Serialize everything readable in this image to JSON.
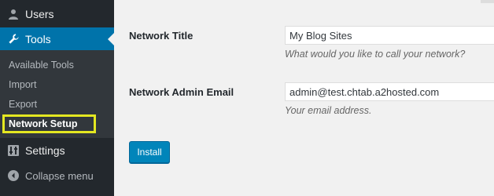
{
  "sidebar": {
    "users": {
      "label": "Users",
      "icon": "user-icon"
    },
    "tools": {
      "label": "Tools",
      "icon": "wrench-icon"
    },
    "submenu": [
      {
        "label": "Available Tools"
      },
      {
        "label": "Import"
      },
      {
        "label": "Export"
      },
      {
        "label": "Network Setup",
        "current": true
      }
    ],
    "settings": {
      "label": "Settings",
      "icon": "settings-sliders-icon"
    },
    "collapse": {
      "label": "Collapse menu",
      "icon": "collapse-arrow-icon"
    }
  },
  "form": {
    "network_title": {
      "label": "Network Title",
      "value": "My Blog Sites",
      "description": "What would you like to call your network?"
    },
    "admin_email": {
      "label": "Network Admin Email",
      "value": "admin@test.chtab.a2hosted.com",
      "description": "Your email address."
    },
    "install_label": "Install"
  },
  "colors": {
    "sidebar_bg": "#23282d",
    "submenu_bg": "#32373c",
    "active_blue": "#0073aa",
    "button_blue": "#0085ba",
    "highlight_yellow": "#e4e721"
  }
}
